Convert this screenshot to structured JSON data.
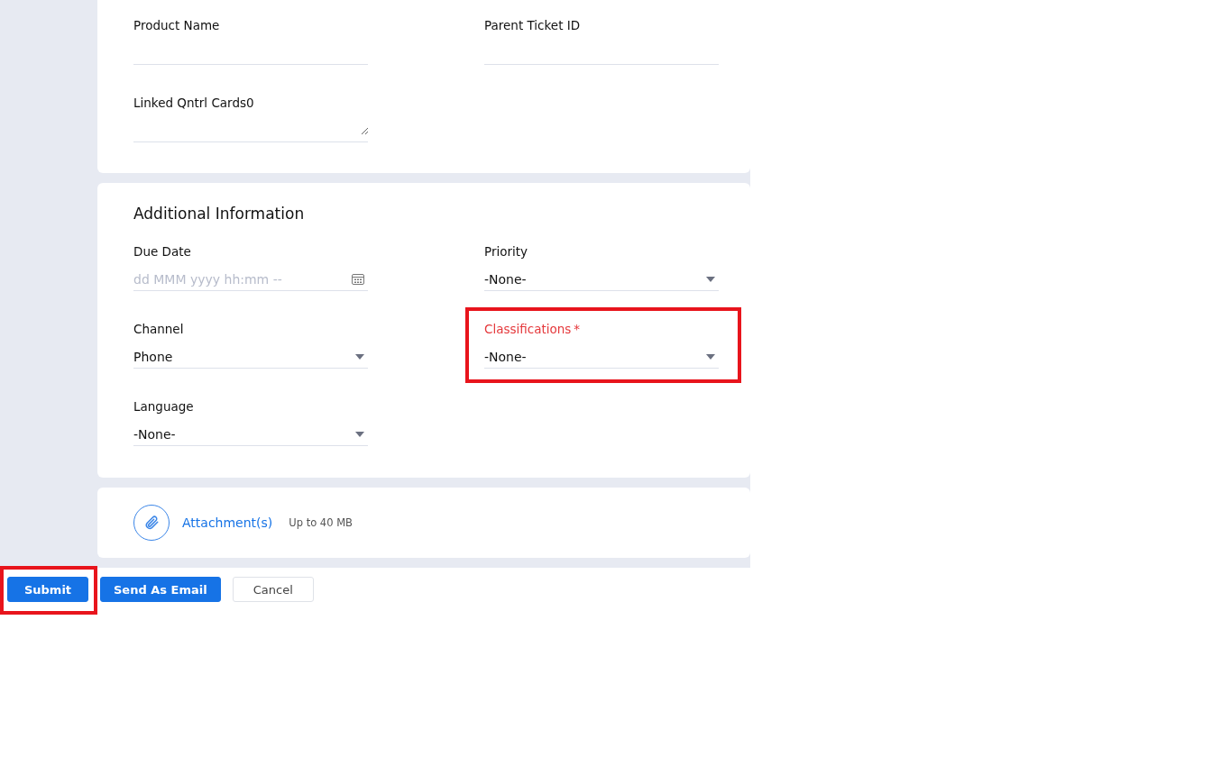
{
  "sections": [
    {
      "fields": [
        {
          "kind": "text",
          "label": "Product Name",
          "required": false,
          "highlighted": false
        },
        {
          "kind": "text",
          "label": "Parent Ticket ID",
          "required": false,
          "highlighted": false
        },
        {
          "kind": "textarea",
          "label": "Linked Qntrl Cards0",
          "required": false,
          "highlighted": false
        }
      ]
    },
    {
      "title": "Additional Information",
      "fields": [
        {
          "kind": "date",
          "label": "Due Date",
          "placeholder": "dd MMM yyyy hh:mm --",
          "required": false,
          "highlighted": false
        },
        {
          "kind": "select",
          "label": "Priority",
          "value": "-None-",
          "required": false,
          "highlighted": false
        },
        {
          "kind": "select",
          "label": "Channel",
          "value": "Phone",
          "required": false,
          "highlighted": false
        },
        {
          "kind": "select",
          "label": "Classifications",
          "value": "-None-",
          "required": true,
          "required_mark": "*",
          "highlighted": true
        },
        {
          "kind": "select",
          "label": "Language",
          "value": "-None-",
          "required": false,
          "highlighted": false
        }
      ]
    }
  ],
  "attachment": {
    "label": "Attachment(s)",
    "hint": "Up to 40 MB"
  },
  "buttons": [
    {
      "label": "Submit",
      "kind": "primary",
      "highlighted": true
    },
    {
      "label": "Send As Email",
      "kind": "primary",
      "highlighted": false
    },
    {
      "label": "Cancel",
      "kind": "secondary",
      "highlighted": false
    }
  ]
}
